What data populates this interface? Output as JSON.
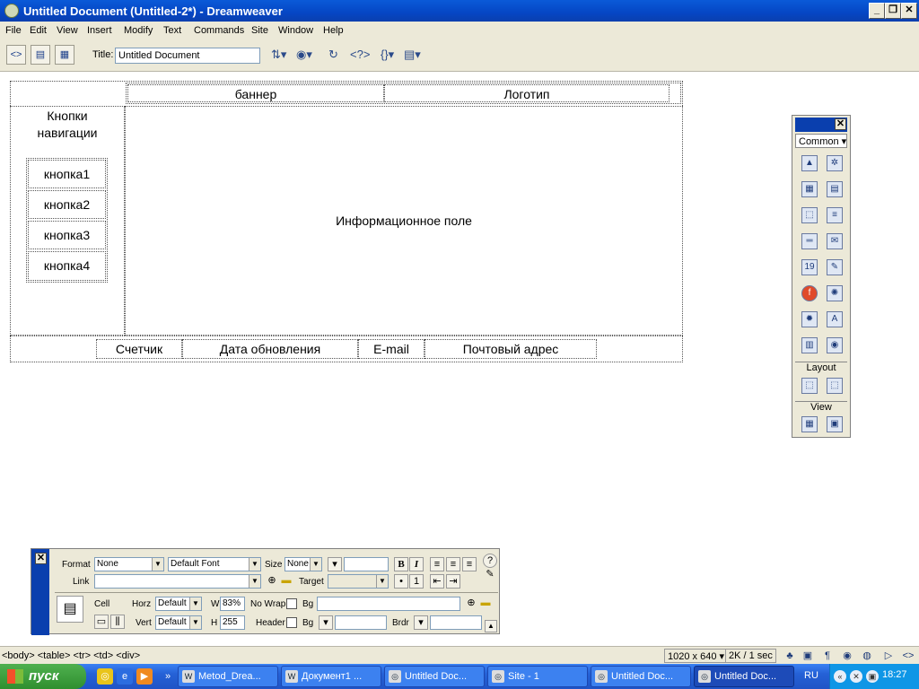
{
  "window": {
    "title": "Untitled Document (Untitled-2*) - Dreamweaver",
    "minimize": "_",
    "restore": "❐",
    "close": "✕"
  },
  "menu": [
    "File",
    "Edit",
    "View",
    "Insert",
    "Modify",
    "Text",
    "Commands",
    "Site",
    "Window",
    "Help"
  ],
  "toolbar": {
    "title_label": "Title:",
    "title_value": "Untitled Document"
  },
  "document": {
    "banner": "баннер",
    "logo": "Логотип",
    "nav_heading_line1": "Кнопки",
    "nav_heading_line2": "навигации",
    "buttons": [
      "кнопка1",
      "кнопка2",
      "кнопка3",
      "кнопка4"
    ],
    "info_field": "Информационное поле",
    "footer": {
      "counter": "Счетчик",
      "update_date": "Дата обновления",
      "email": "E-mail",
      "postal": "Почтовый адрес"
    }
  },
  "insert_panel": {
    "category": "Common",
    "layout_label": "Layout",
    "view_label": "View",
    "close": "✕"
  },
  "properties": {
    "format_label": "Format",
    "format_value": "None",
    "font_value": "Default Font",
    "size_label": "Size",
    "size_value": "None",
    "link_label": "Link",
    "target_label": "Target",
    "bold": "B",
    "italic": "I",
    "cell_label": "Cell",
    "horz_label": "Horz",
    "horz_value": "Default",
    "vert_label": "Vert",
    "vert_value": "Default",
    "w_label": "W",
    "w_value": "83%",
    "h_label": "H",
    "h_value": "255",
    "nowrap_label": "No Wrap",
    "header_label": "Header",
    "bg_label": "Bg",
    "bg2_label": "Bg",
    "brdr_label": "Brdr",
    "help": "?"
  },
  "status": {
    "tag_path": "<body> <table> <tr> <td> <div>",
    "window_size": "1020 x 640",
    "download": "2K / 1 sec"
  },
  "taskbar": {
    "start": "пуск",
    "tasks": [
      "Metod_Drea...",
      "Документ1 ...",
      "Untitled Doc...",
      "Site - 1",
      "Untitled Doc...",
      "Untitled Doc..."
    ],
    "lang": "RU",
    "clock": "18:27"
  }
}
